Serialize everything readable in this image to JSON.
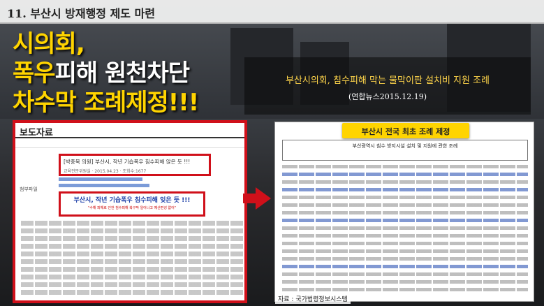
{
  "slide": {
    "section_title": "11. 부산시 방재행정 제도 마련",
    "headline": {
      "line1": "시의회,",
      "line2_part1": "폭우",
      "line2_part2": "피해 원천차단",
      "line3": "차수막 조례제정!!!"
    },
    "news": {
      "title": "부산시의회, 침수피해 막는 물막이판 설치비 지원 조례",
      "citation": "(연합뉴스2015.12.19)"
    },
    "press_doc": {
      "header": "보도자료",
      "title_box": "[박중묵 의원] 부산시, 작년 기습폭우 침수피해 앉은 듯 !!!",
      "title_sub": "교육전문위원실 · 2015.04.23 · 조회수:1677",
      "label": "첨부파일",
      "headline_box": "부산시, 작년 기습폭우 침수피해 잊은 듯 !!!",
      "headline_sub": "\"수해 피해로 인한 침수피해 복구작 일어나고 예산편성 없어\""
    },
    "ordinance": {
      "badge": "부산시 전국 최초 조례 제정",
      "title": "부산광역시 침수 방지시설 설치 및 지원에 관한 조례"
    },
    "source": "자료 : 국가법령정보시스템"
  }
}
